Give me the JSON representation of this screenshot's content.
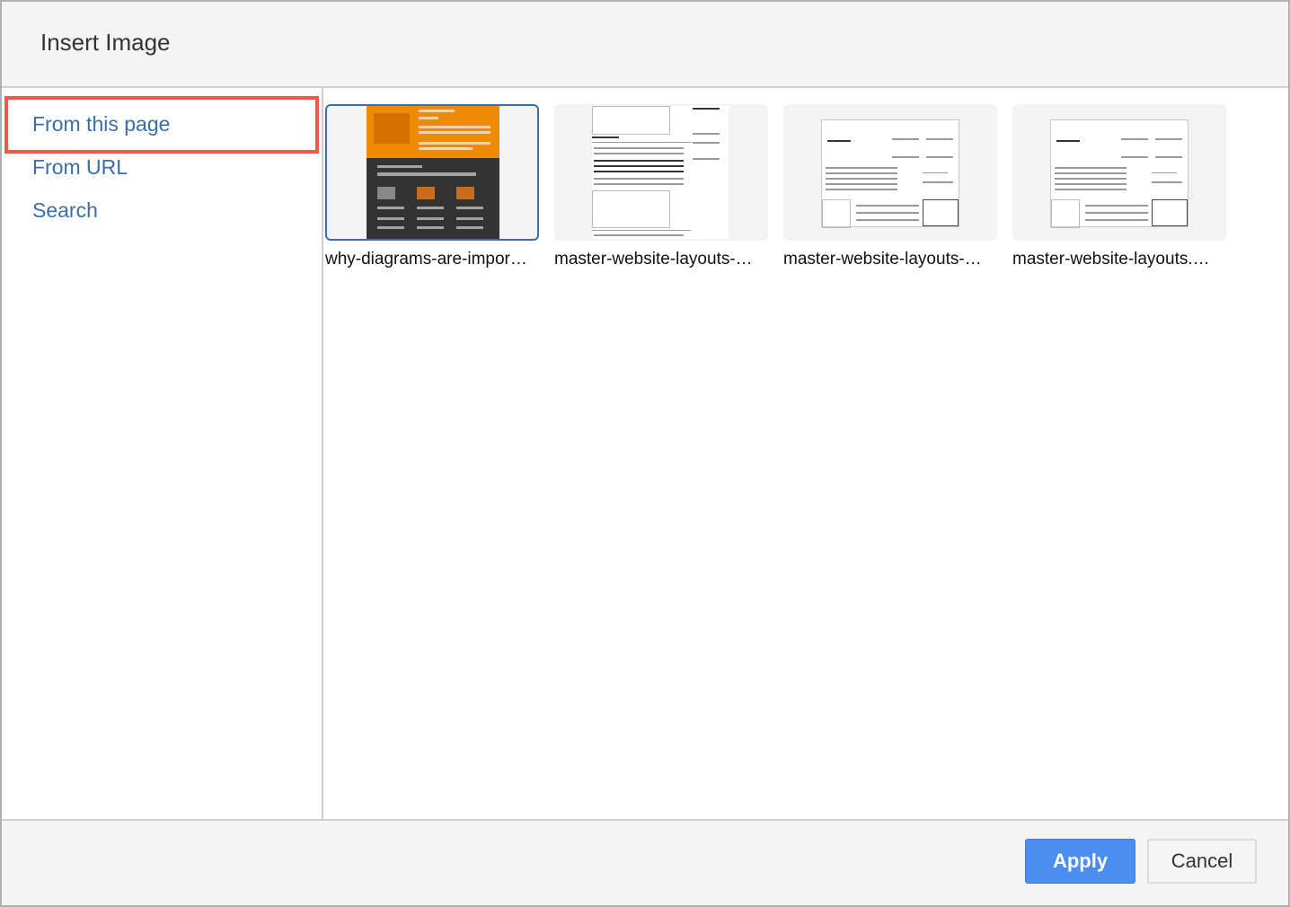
{
  "dialog": {
    "title": "Insert Image"
  },
  "sidebar": {
    "items": [
      {
        "label": "From this page",
        "selected": true
      },
      {
        "label": "From URL",
        "selected": false
      },
      {
        "label": "Search",
        "selected": false
      }
    ],
    "highlight_color": "#f0584a"
  },
  "images": [
    {
      "label": "why-diagrams-are-impor…",
      "selected": true,
      "thumbnail": "infographic-orange-dark"
    },
    {
      "label": "master-website-layouts-…",
      "selected": false,
      "thumbnail": "article-layout-wireframe"
    },
    {
      "label": "master-website-layouts-…",
      "selected": false,
      "thumbnail": "website-name-wireframe"
    },
    {
      "label": "master-website-layouts.…",
      "selected": false,
      "thumbnail": "website-name-wireframe"
    }
  ],
  "footer": {
    "apply_label": "Apply",
    "cancel_label": "Cancel",
    "accent_color": "#4a8ef0"
  }
}
